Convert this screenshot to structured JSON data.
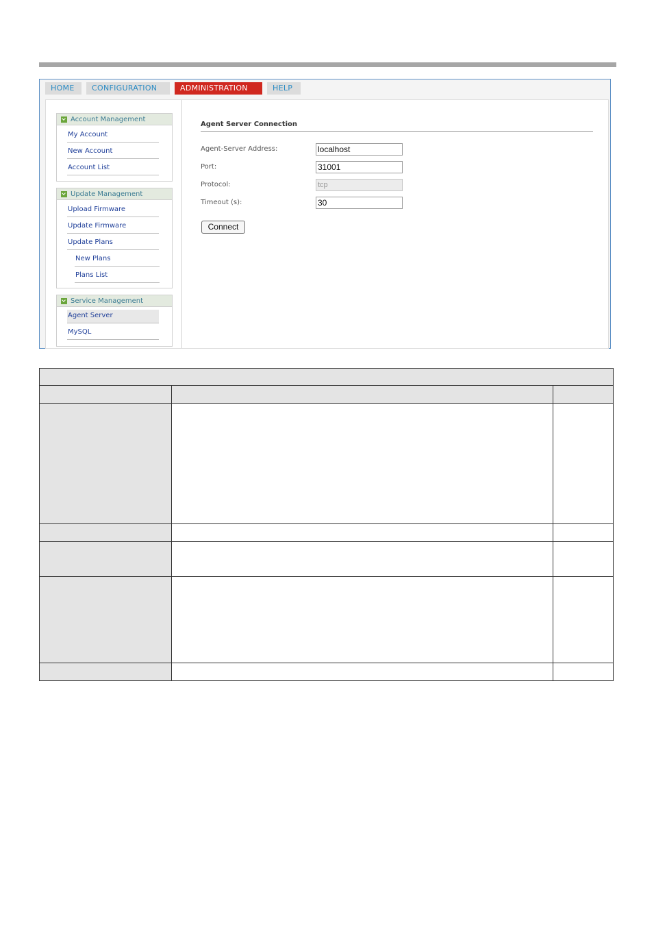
{
  "nav": {
    "tabs": [
      {
        "label": "HOME"
      },
      {
        "label": "CONFIGURATION"
      },
      {
        "label": "ADMINISTRATION",
        "active": true
      },
      {
        "label": "HELP"
      }
    ]
  },
  "sidebar": {
    "account_management": {
      "title": "Account Management",
      "items": [
        "My Account",
        "New Account",
        "Account List"
      ]
    },
    "update_management": {
      "title": "Update Management",
      "items": [
        "Upload Firmware",
        "Update Firmware",
        "Update Plans",
        "New Plans",
        "Plans List"
      ]
    },
    "service_management": {
      "title": "Service Management",
      "items": [
        "Agent Server",
        "MySQL"
      ],
      "selected": "Agent Server"
    }
  },
  "main": {
    "section_title": "Agent Server Connection",
    "fields": [
      {
        "label": "Agent-Server Address:",
        "value": "localhost"
      },
      {
        "label": "Port:",
        "value": "31001"
      },
      {
        "label": "Protocol:",
        "value": "tcp",
        "disabled": true
      },
      {
        "label": "Timeout (s):",
        "value": "30"
      }
    ],
    "connect_label": "Connect"
  },
  "colors": {
    "active_tab": "#d0281f",
    "tab_text": "#2a8bc4",
    "link_text": "#1f3f99",
    "frame_border": "#5b8fc5"
  }
}
